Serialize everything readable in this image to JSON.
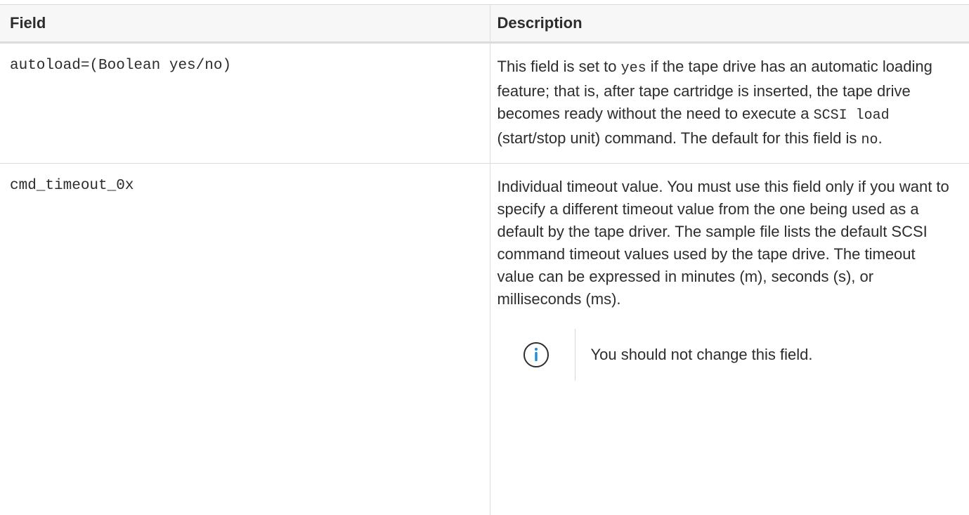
{
  "table": {
    "headers": [
      "Field",
      "Description"
    ],
    "rows": [
      {
        "field": "autoload=(Boolean yes/no)",
        "desc": {
          "p1": "This field is set to ",
          "c1": "yes",
          "p2": " if the tape drive has an automatic loading feature; that is, after tape cartridge is inserted, the tape drive becomes ready without the need to execute a ",
          "c2": "SCSI load",
          "p3": " (start/stop unit) command. The default for this field is ",
          "c3": "no",
          "p4": "."
        }
      },
      {
        "field": "cmd_timeout_0x",
        "desc": "Individual timeout value. You must use this field only if you want to specify a different timeout value from the one being used as a default by the tape driver. The sample file lists the default SCSI command timeout values used by the tape drive. The timeout value can be expressed in minutes (m), seconds (s), or milliseconds (ms).",
        "note": {
          "icon": "info-icon",
          "text": "You should not change this field."
        }
      }
    ]
  },
  "colors": {
    "text": "#2d2d2d",
    "header_bg": "#f7f7f7",
    "border": "#dcdcdc",
    "info_icon": "#1a8fd6"
  }
}
